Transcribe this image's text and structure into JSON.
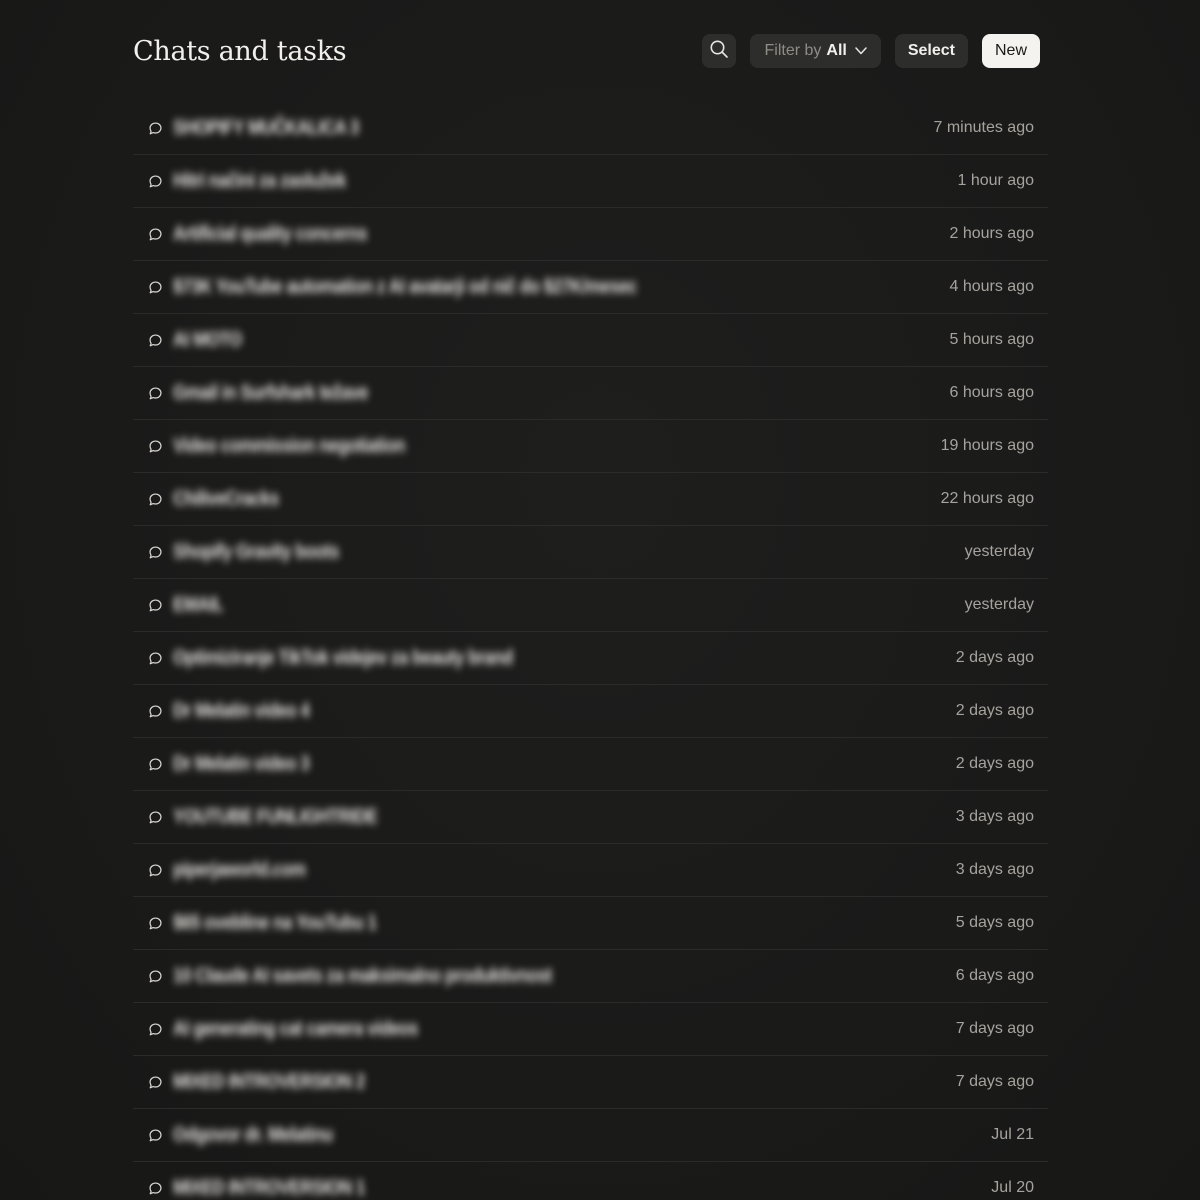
{
  "header": {
    "title": "Chats and tasks",
    "search_icon": "search-icon",
    "filter_label": "Filter by",
    "filter_value": "All",
    "select_label": "Select",
    "new_label": "New"
  },
  "chats": [
    {
      "title": "SHOPIFY MUČKALICA 3",
      "time": "7 minutes ago"
    },
    {
      "title": "Hitri načini za zaslužek",
      "time": "1 hour ago"
    },
    {
      "title": "Artificial quality concerns",
      "time": "2 hours ago"
    },
    {
      "title": "$73K YouTube automation z AI avatarji od nič do $27K/mesec",
      "time": "4 hours ago"
    },
    {
      "title": "AI MOTO",
      "time": "5 hours ago"
    },
    {
      "title": "Gmail in Surfshark težave",
      "time": "6 hours ago"
    },
    {
      "title": "Video commission negotiation",
      "time": "19 hours ago"
    },
    {
      "title": "ChiliveCracks",
      "time": "22 hours ago"
    },
    {
      "title": "Shopify Gravity boots",
      "time": "yesterday"
    },
    {
      "title": "EMAIL",
      "time": "yesterday"
    },
    {
      "title": "Optimiziranje TikTok videjev za beauty brand",
      "time": "2 days ago"
    },
    {
      "title": "Dr Melatin video 4",
      "time": "2 days ago"
    },
    {
      "title": "Dr Melatin video 3",
      "time": "2 days ago"
    },
    {
      "title": "YOUTUBE FUNLIGHTRIDE",
      "time": "3 days ago"
    },
    {
      "title": "piperjaworld.com",
      "time": "3 days ago"
    },
    {
      "title": "$65 ovebline na YouTubu 1",
      "time": "5 days ago"
    },
    {
      "title": "10 Claude AI savets za maksimalno produktivnost",
      "time": "6 days ago"
    },
    {
      "title": "AI generating cat camera videos",
      "time": "7 days ago"
    },
    {
      "title": "MIXED INTROVERSION 2",
      "time": "7 days ago"
    },
    {
      "title": "Odgovor dr. Melatinu",
      "time": "Jul 21"
    },
    {
      "title": "MIXED INTROVERSION 1",
      "time": "Jul 20"
    }
  ]
}
